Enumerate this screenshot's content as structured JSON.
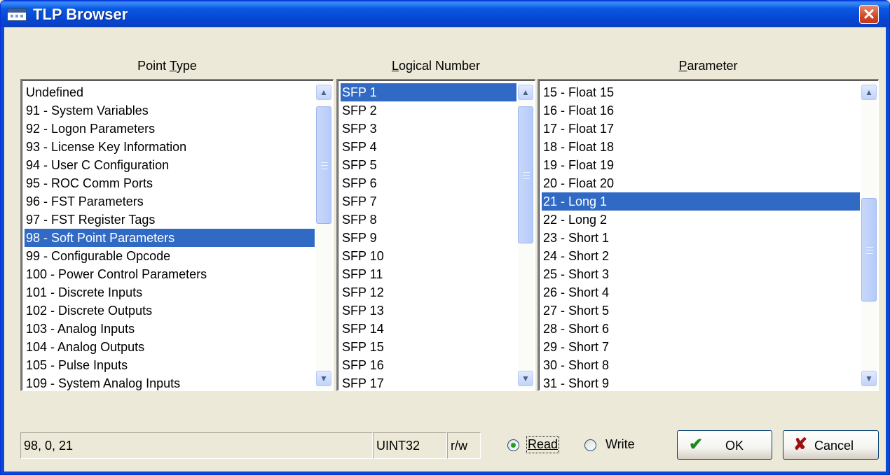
{
  "window": {
    "title": "TLP Browser"
  },
  "point_type": {
    "label_pre": "Point ",
    "label_ul": "T",
    "label_post": "ype",
    "items": [
      "Undefined",
      "91 - System Variables",
      "92 - Logon Parameters",
      "93 - License Key Information",
      "94 - User C Configuration",
      "95 - ROC Comm Ports",
      "96 - FST Parameters",
      "97 - FST Register Tags",
      "98 - Soft Point Parameters",
      "99 - Configurable Opcode",
      "100 - Power Control Parameters",
      "101 - Discrete Inputs",
      "102 - Discrete Outputs",
      "103 - Analog Inputs",
      "104 - Analog Outputs",
      "105 - Pulse Inputs",
      "109 - System Analog Inputs"
    ],
    "selected": "98 - Soft Point Parameters"
  },
  "logical_number": {
    "label_pre": "",
    "label_ul": "L",
    "label_post": "ogical Number",
    "items": [
      "SFP 1",
      "SFP 2",
      "SFP 3",
      "SFP 4",
      "SFP 5",
      "SFP 6",
      "SFP 7",
      "SFP 8",
      "SFP 9",
      "SFP 10",
      "SFP 11",
      "SFP 12",
      "SFP 13",
      "SFP 14",
      "SFP 15",
      "SFP 16",
      "SFP 17"
    ],
    "selected": "SFP 1"
  },
  "parameter": {
    "label_pre": "",
    "label_ul": "P",
    "label_post": "arameter",
    "items": [
      "15 - Float 15",
      "16 - Float 16",
      "17 - Float 17",
      "18 - Float 18",
      "19 - Float 19",
      "20 - Float 20",
      "21 - Long 1",
      "22 - Long 2",
      "23 - Short 1",
      "24 - Short 2",
      "25 - Short 3",
      "26 - Short 4",
      "27 - Short 5",
      "28 - Short 6",
      "29 - Short 7",
      "30 - Short 8",
      "31 - Short 9"
    ],
    "selected": "21 - Long 1"
  },
  "status": {
    "tlp": "98, 0, 21",
    "data_type": "UINT32",
    "access": "r/w"
  },
  "access_mode": {
    "read_label": "Read",
    "write_label": "Write",
    "selected": "Read"
  },
  "buttons": {
    "ok": "OK",
    "cancel": "Cancel"
  },
  "colors": {
    "selection": "#316ac5",
    "titlebar": "#0a58e2",
    "ok_check": "#1e8a1e",
    "cancel_x": "#a01010"
  }
}
